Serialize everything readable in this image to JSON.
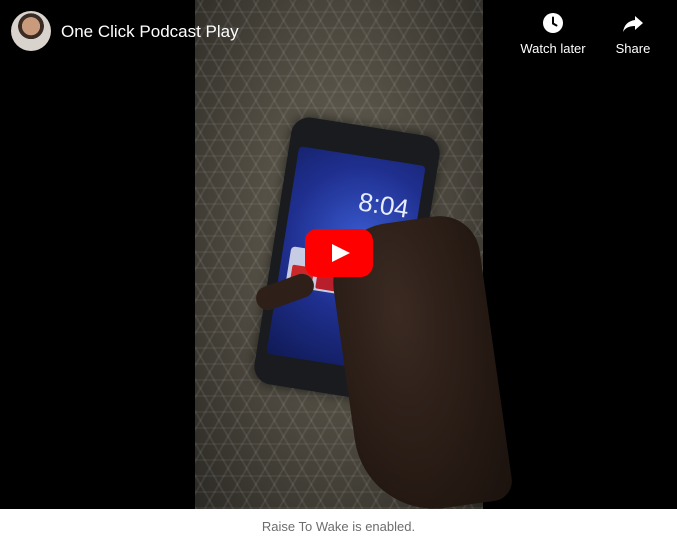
{
  "header": {
    "title": "One Click Podcast Play",
    "avatar_icon": "channel-avatar"
  },
  "actions": {
    "watch_later": {
      "label": "Watch later",
      "icon": "clock-icon"
    },
    "share": {
      "label": "Share",
      "icon": "share-arrow-icon"
    }
  },
  "video": {
    "play_icon": "play-icon",
    "brand_color": "#ff0000",
    "lock_screen_time": "8:04"
  },
  "caption": "Raise To Wake is enabled."
}
